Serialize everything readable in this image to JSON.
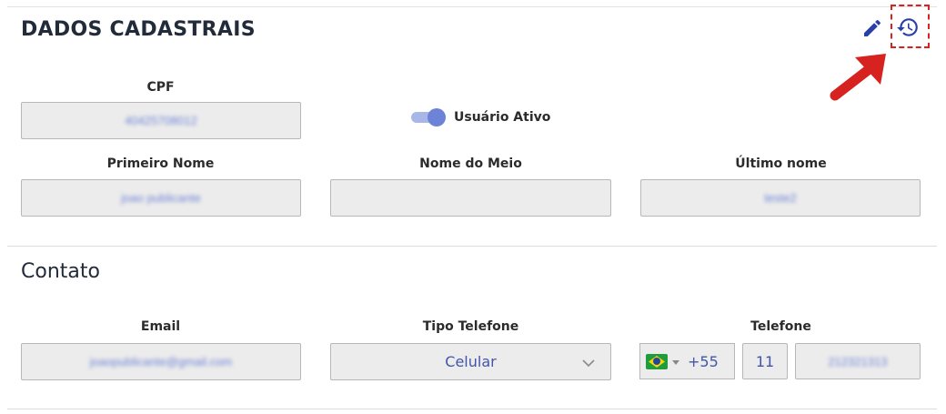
{
  "section1": {
    "title": "DADOS CADASTRAIS",
    "cpf_label": "CPF",
    "cpf_value": "40425708012",
    "toggle_label": "Usuário Ativo",
    "first_name_label": "Primeiro Nome",
    "first_name_value": "joao publicante",
    "middle_name_label": "Nome do Meio",
    "middle_name_value": "",
    "last_name_label": "Último nome",
    "last_name_value": "teste2",
    "toggle_state": true
  },
  "section2": {
    "title": "Contato",
    "email_label": "Email",
    "email_value": "joaopublicante@gmail.com",
    "phone_type_label": "Tipo Telefone",
    "phone_type_value": "Celular",
    "phone_label": "Telefone",
    "country_dial_code": "+55",
    "area_code": "11",
    "phone_number": "212321313"
  },
  "icons": {
    "edit": "pencil-icon",
    "history": "history-icon",
    "annotation": "red-arrow"
  },
  "colors": {
    "accent": "#2b3fa8",
    "annotation_red": "#d6231f",
    "field_bg": "#ececec"
  }
}
